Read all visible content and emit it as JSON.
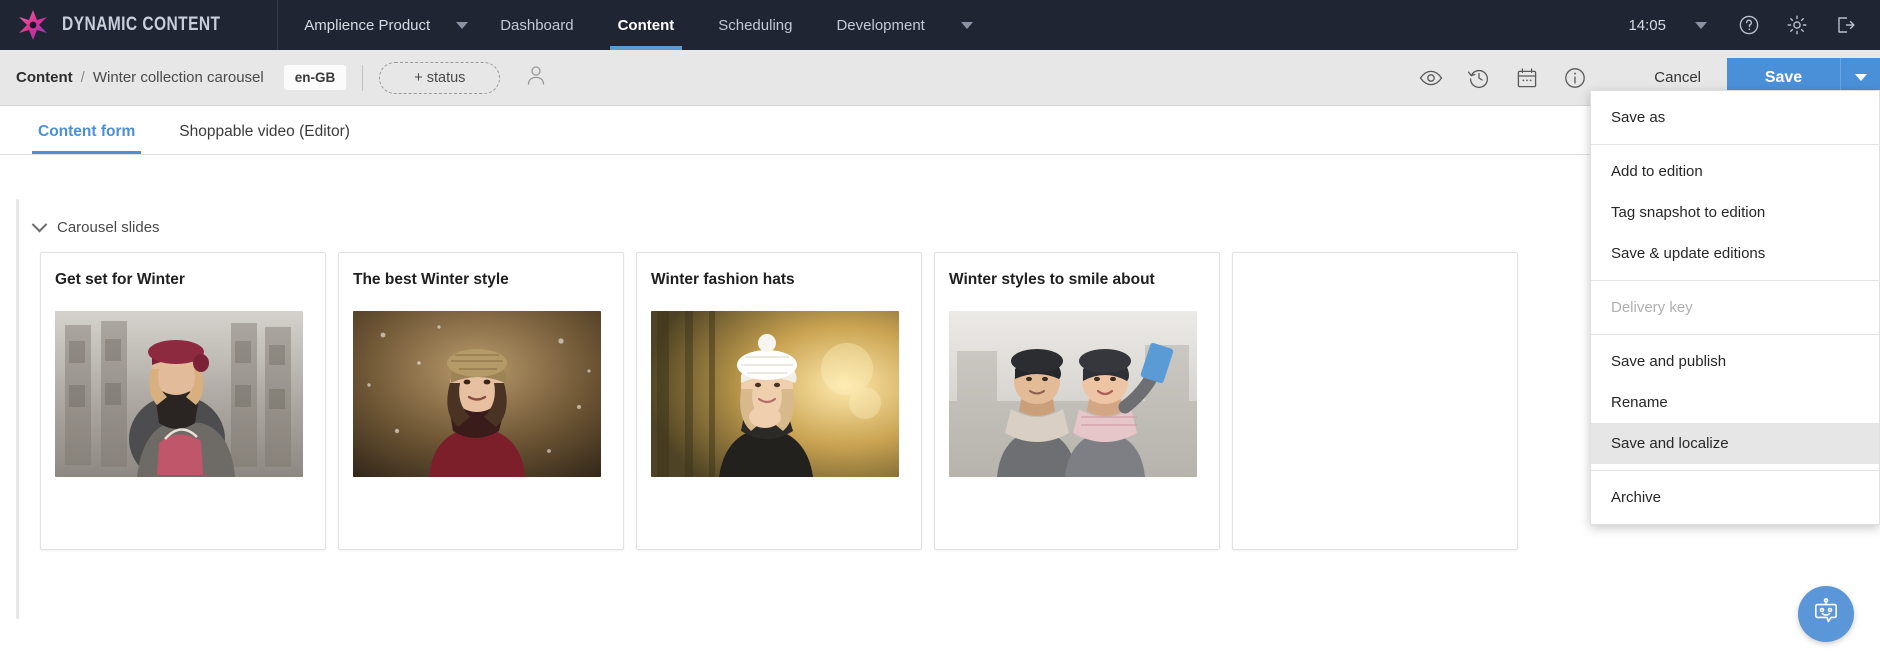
{
  "topnav": {
    "logo_text": "DYNAMIC CONTENT",
    "logo_icon": "amplience-star-logo-icon",
    "org_selector": {
      "label": "Amplience Product",
      "icon": "chevron-down-icon"
    },
    "items": [
      {
        "label": "Dashboard",
        "active": false
      },
      {
        "label": "Content",
        "active": true
      },
      {
        "label": "Scheduling",
        "active": false
      },
      {
        "label": "Development",
        "active": false
      }
    ],
    "more_icon": "chevron-down-icon",
    "clock": "14:05",
    "clock_caret_icon": "chevron-down-icon",
    "help_icon": "help-circle-icon",
    "settings_icon": "gear-icon",
    "logout_icon": "logout-icon"
  },
  "subheader": {
    "breadcrumb_root": "Content",
    "breadcrumb_sep": "/",
    "breadcrumb_name": "Winter collection carousel",
    "locale": "en-GB",
    "status_label": "+ status",
    "avatar_icon": "user-avatar-icon",
    "icons": [
      {
        "name": "preview-eye-icon"
      },
      {
        "name": "version-history-icon"
      },
      {
        "name": "calendar-icon"
      },
      {
        "name": "info-icon"
      }
    ],
    "cancel_label": "Cancel",
    "save_label": "Save",
    "save_caret_icon": "chevron-down-icon"
  },
  "tabs": [
    {
      "label": "Content form",
      "active": true
    },
    {
      "label": "Shoppable video (Editor)",
      "active": false
    }
  ],
  "section": {
    "collapse_icon": "chevron-down-icon",
    "title": "Carousel slides"
  },
  "cards": [
    {
      "title": "Get set for Winter",
      "image_alt": "woman-in-burgundy-beret-with-pink-handbag"
    },
    {
      "title": "The best Winter style",
      "image_alt": "woman-in-knitted-hat-smiling-in-snow"
    },
    {
      "title": "Winter fashion hats",
      "image_alt": "woman-in-white-bobble-hat-autumn-light"
    },
    {
      "title": "Winter styles to smile about",
      "image_alt": "couple-taking-selfie-in-winter-coats"
    },
    {
      "title": "",
      "image_alt": ""
    }
  ],
  "save_menu": {
    "items": [
      {
        "label": "Save as",
        "state": "normal",
        "separator_after": true
      },
      {
        "label": "Add to edition",
        "state": "normal",
        "separator_after": false
      },
      {
        "label": "Tag snapshot to edition",
        "state": "normal",
        "separator_after": false
      },
      {
        "label": "Save & update editions",
        "state": "normal",
        "separator_after": true
      },
      {
        "label": "Delivery key",
        "state": "disabled",
        "separator_after": true
      },
      {
        "label": "Save and publish",
        "state": "normal",
        "separator_after": false
      },
      {
        "label": "Rename",
        "state": "normal",
        "separator_after": false
      },
      {
        "label": "Save and localize",
        "state": "hover",
        "separator_after": true
      },
      {
        "label": "Archive",
        "state": "normal",
        "separator_after": false
      }
    ]
  },
  "chatbot": {
    "icon": "chatbot-robot-icon"
  },
  "colors": {
    "nav_bg": "#1f2533",
    "accent_blue": "#4a90d9",
    "subheader_bg": "#e7e7e7",
    "menu_hover": "#e6e6e6"
  }
}
